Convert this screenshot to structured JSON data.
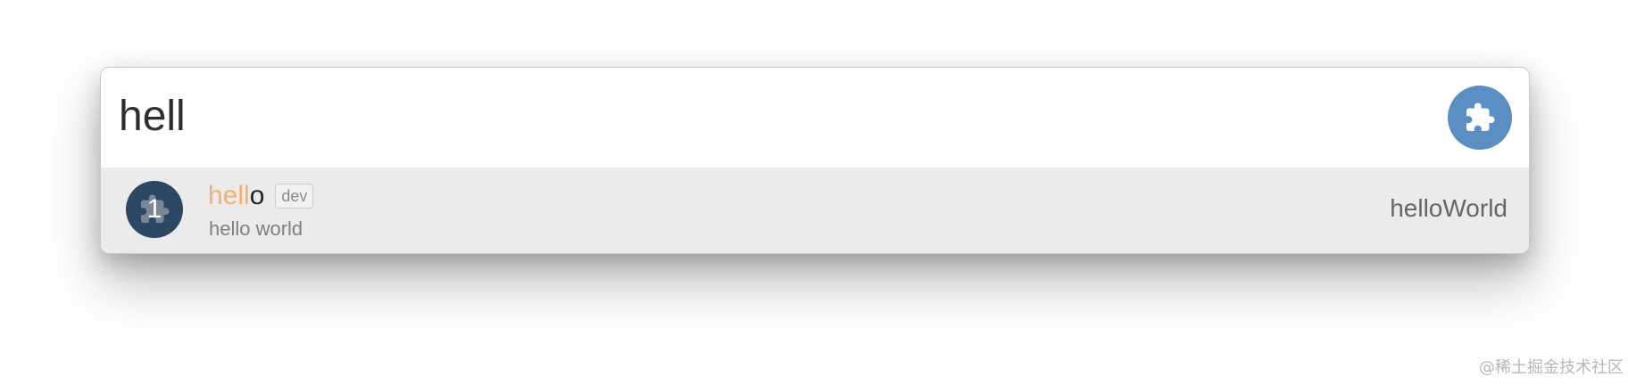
{
  "search": {
    "query": "hell"
  },
  "results": [
    {
      "index": "1",
      "title_match": "hell",
      "title_rest": "o",
      "tag": "dev",
      "description": "hello world",
      "command": "helloWorld"
    }
  ],
  "icons": {
    "plugin_button": "puzzle-piece-icon",
    "result_avatar": "puzzle-piece-icon"
  },
  "colors": {
    "accent": "#5b8fc4",
    "match_highlight": "#f5b070",
    "avatar_bg": "#2c4865",
    "results_bg": "#ebebeb"
  },
  "watermark": "@稀土掘金技术社区"
}
